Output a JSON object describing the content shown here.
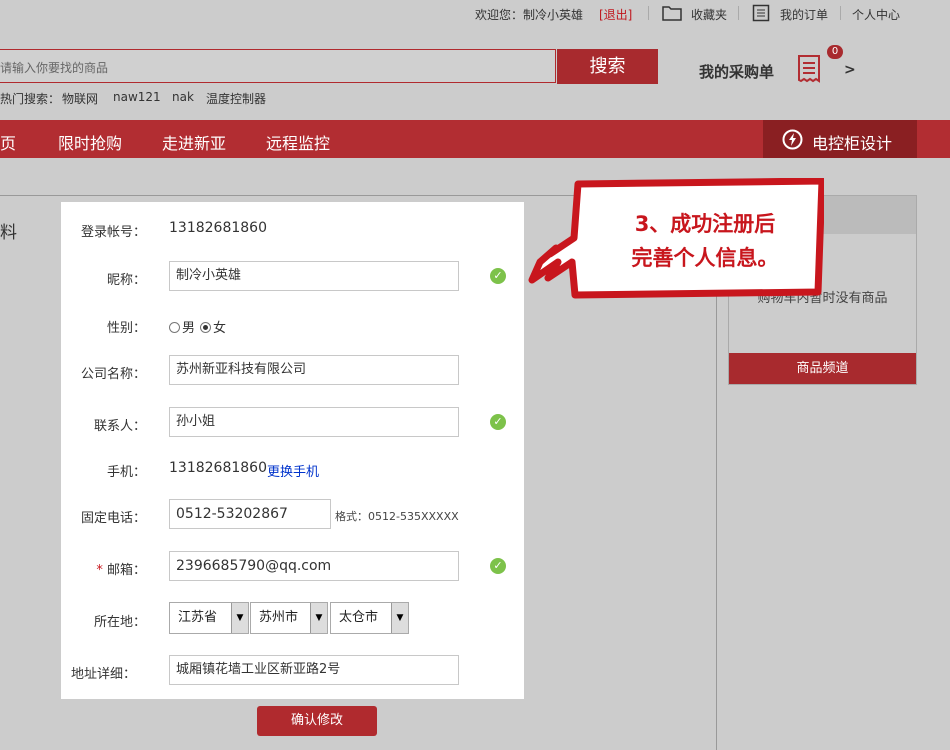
{
  "topbar": {
    "welcome": "欢迎您：制冷小英雄",
    "logout": "[退出]",
    "favorites": "收藏夹",
    "orders": "我的订单",
    "account": "个人中心"
  },
  "search": {
    "placeholder": "请输入你要找的商品",
    "button": "搜索",
    "hot_label": "热门搜索：",
    "hot_terms": [
      "物联网",
      "naw121",
      "nak",
      "温度控制器"
    ]
  },
  "cart": {
    "label": "我的采购单",
    "count": "0",
    "chevron": ">"
  },
  "nav": {
    "items": [
      "页",
      "限时抢购",
      "走进新亚",
      "远程监控"
    ],
    "design": "电控柜设计"
  },
  "side_title": "料",
  "right_panel": {
    "empty": "购物车内暂时没有商品",
    "button": "商品频道"
  },
  "callout": {
    "line1": "3、成功注册后",
    "line2": "完善个人信息。"
  },
  "form": {
    "account_label": "登录帐号：",
    "account_value": "13182681860",
    "nickname_label": "昵称：",
    "nickname_value": "制冷小英雄",
    "gender_label": "性别：",
    "gender_male": "男",
    "gender_female": "女",
    "company_label": "公司名称：",
    "company_value": "苏州新亚科技有限公司",
    "contact_label": "联系人：",
    "contact_value": "孙小姐",
    "phone_label": "手机：",
    "phone_value": "13182681860",
    "phone_change": "更换手机",
    "tel_label": "固定电话：",
    "tel_value": "0512-53202867",
    "tel_hint": "格式：0512-535XXXXX",
    "email_required": "*",
    "email_label": "邮箱：",
    "email_value": "2396685790@qq.com",
    "location_label": "所在地：",
    "province": "江苏省",
    "city": "苏州市",
    "district": "太仓市",
    "address_label": "地址详细：",
    "address_value": "城厢镇花墙工业区新亚路2号",
    "submit": "确认修改"
  },
  "colors": {
    "brand_red": "#b22d32",
    "ok_green": "#7dc24a",
    "link_blue": "#0033cc"
  },
  "icons": [
    "folder-icon",
    "order-list-icon",
    "receipt-icon",
    "lightning-icon",
    "check-icon",
    "dropdown-arrow-icon"
  ]
}
